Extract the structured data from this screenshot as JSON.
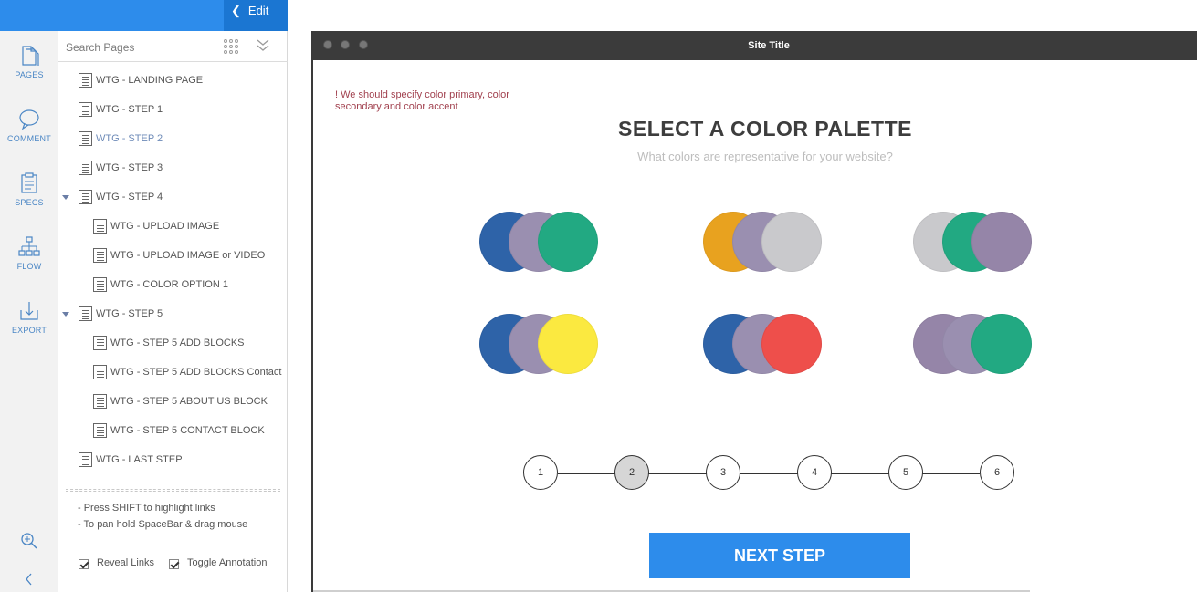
{
  "toolbar": {
    "edit_label": "Edit"
  },
  "rail": {
    "items": [
      {
        "label": "PAGES",
        "icon": "pages-icon"
      },
      {
        "label": "COMMENT",
        "icon": "comment-icon"
      },
      {
        "label": "SPECS",
        "icon": "specs-icon"
      },
      {
        "label": "FLOW",
        "icon": "flow-icon"
      },
      {
        "label": "EXPORT",
        "icon": "export-icon"
      }
    ],
    "bottom_icons": [
      "zoom-icon",
      "collapse-left-icon"
    ]
  },
  "search": {
    "placeholder": "Search Pages",
    "value": ""
  },
  "pages": [
    {
      "label": "WTG - LANDING PAGE",
      "level": 0
    },
    {
      "label": "WTG - STEP 1",
      "level": 0
    },
    {
      "label": "WTG - STEP 2",
      "level": 0,
      "active": true
    },
    {
      "label": "WTG - STEP 3",
      "level": 0
    },
    {
      "label": "WTG - STEP 4",
      "level": 0,
      "expanded": true
    },
    {
      "label": "WTG - UPLOAD IMAGE",
      "level": 1
    },
    {
      "label": "WTG - UPLOAD IMAGE or VIDEO",
      "level": 1
    },
    {
      "label": "WTG - COLOR OPTION 1",
      "level": 1
    },
    {
      "label": "WTG - STEP 5",
      "level": 0,
      "expanded": true
    },
    {
      "label": "WTG - STEP 5 ADD BLOCKS",
      "level": 1
    },
    {
      "label": "WTG - STEP 5 ADD BLOCKS Contact",
      "level": 1
    },
    {
      "label": "WTG - STEP 5 ABOUT US BLOCK",
      "level": 1
    },
    {
      "label": "WTG - STEP 5 CONTACT BLOCK",
      "level": 1
    },
    {
      "label": "WTG - LAST STEP",
      "level": 0
    }
  ],
  "hints": {
    "line1": "- Press SHIFT to highlight links",
    "line2": "- To pan hold SpaceBar & drag mouse"
  },
  "options": {
    "reveal_links": {
      "label": "Reveal Links",
      "checked": true
    },
    "toggle_annotation": {
      "label": "Toggle Annotation",
      "checked": true
    }
  },
  "window": {
    "title": "Site Title"
  },
  "site": {
    "annotation": "! We should specify color primary, color secondary and color accent",
    "heading": "SELECT A COLOR PALETTE",
    "subheading": "What colors are representative for your website?",
    "palettes": [
      [
        "#2e63a8",
        "#9a8fb0",
        "#22a982"
      ],
      [
        "#e8a21f",
        "#9a8fb0",
        "#c9c9cc"
      ],
      [
        "#c9c9cc",
        "#22a982",
        "#9585a8"
      ],
      [
        "#2e63a8",
        "#9a8fb0",
        "#fbe940"
      ],
      [
        "#2e63a8",
        "#9a8fb0",
        "#ee4f4b"
      ],
      [
        "#9585a8",
        "#9a8fb0",
        "#22a982"
      ]
    ],
    "steps": [
      "1",
      "2",
      "3",
      "4",
      "5",
      "6"
    ],
    "current_step": "2",
    "next_label": "NEXT STEP"
  },
  "colors": {
    "accent": "#2d8ceb",
    "edit_bg": "#1b76d2",
    "window_bar": "#3b3b3b",
    "note": "#a1404e"
  }
}
